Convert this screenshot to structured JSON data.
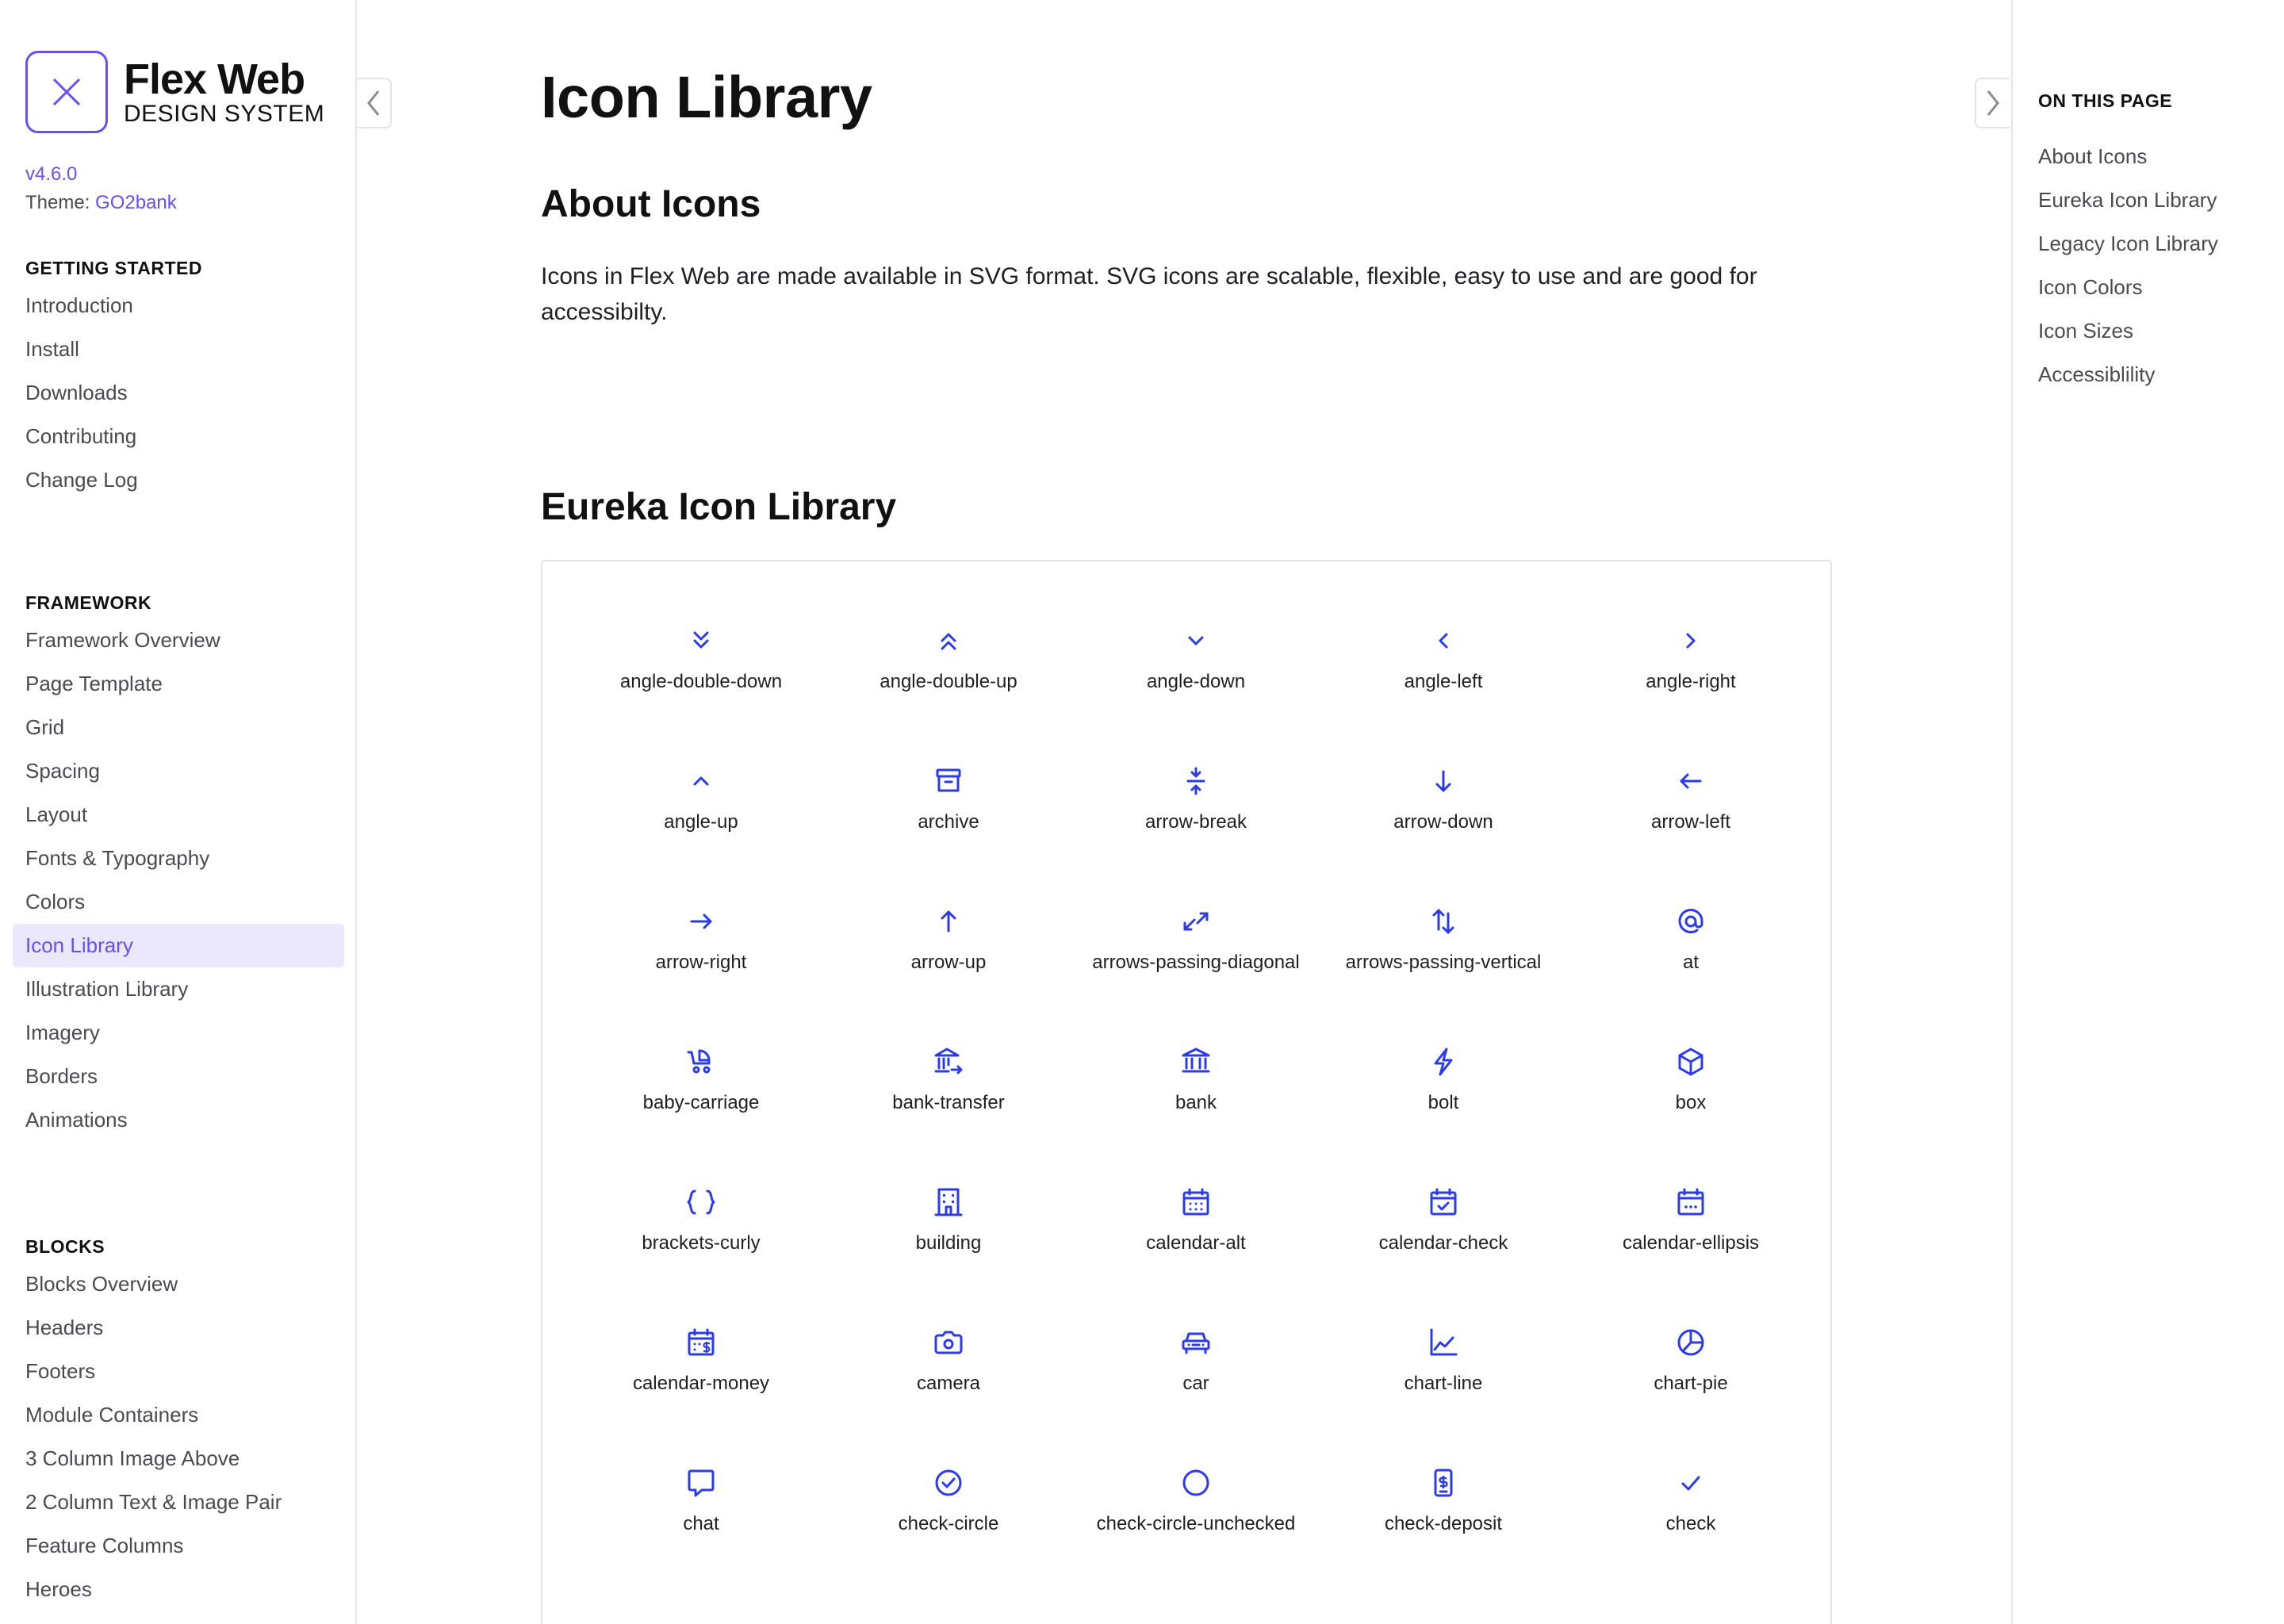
{
  "brand": {
    "title": "Flex Web",
    "subtitle": "DESIGN SYSTEM",
    "version": "v4.6.0",
    "theme_label": "Theme:",
    "theme_value": "GO2bank",
    "accent": "#6a4ff0"
  },
  "sidebar": {
    "sections": [
      {
        "heading": "GETTING STARTED",
        "items": [
          "Introduction",
          "Install",
          "Downloads",
          "Contributing",
          "Change Log"
        ]
      },
      {
        "heading": "FRAMEWORK",
        "items": [
          "Framework Overview",
          "Page Template",
          "Grid",
          "Spacing",
          "Layout",
          "Fonts & Typography",
          "Colors",
          "Icon Library",
          "Illustration Library",
          "Imagery",
          "Borders",
          "Animations"
        ],
        "active": "Icon Library"
      },
      {
        "heading": "BLOCKS",
        "items": [
          "Blocks Overview",
          "Headers",
          "Footers",
          "Module Containers",
          "3 Column Image Above",
          "2 Column Text & Image Pair",
          "Feature Columns",
          "Heroes"
        ]
      }
    ]
  },
  "main": {
    "title": "Icon Library",
    "about_heading": "About Icons",
    "about_text": "Icons in Flex Web are made available in SVG format. SVG icons are scalable, flexible, easy to use and are good for accessibilty.",
    "eureka_heading": "Eureka Icon Library",
    "icon_color": "#2b3bea",
    "icons": [
      {
        "label": "angle-double-down",
        "icon": "angle-double-down-icon"
      },
      {
        "label": "angle-double-up",
        "icon": "angle-double-up-icon"
      },
      {
        "label": "angle-down",
        "icon": "angle-down-icon"
      },
      {
        "label": "angle-left",
        "icon": "angle-left-icon"
      },
      {
        "label": "angle-right",
        "icon": "angle-right-icon"
      },
      {
        "label": "angle-up",
        "icon": "angle-up-icon"
      },
      {
        "label": "archive",
        "icon": "archive-icon"
      },
      {
        "label": "arrow-break",
        "icon": "arrow-break-icon"
      },
      {
        "label": "arrow-down",
        "icon": "arrow-down-icon"
      },
      {
        "label": "arrow-left",
        "icon": "arrow-left-icon"
      },
      {
        "label": "arrow-right",
        "icon": "arrow-right-icon"
      },
      {
        "label": "arrow-up",
        "icon": "arrow-up-icon"
      },
      {
        "label": "arrows-passing-diagonal",
        "icon": "arrows-passing-diagonal-icon"
      },
      {
        "label": "arrows-passing-vertical",
        "icon": "arrows-passing-vertical-icon"
      },
      {
        "label": "at",
        "icon": "at-icon"
      },
      {
        "label": "baby-carriage",
        "icon": "baby-carriage-icon"
      },
      {
        "label": "bank-transfer",
        "icon": "bank-transfer-icon"
      },
      {
        "label": "bank",
        "icon": "bank-icon"
      },
      {
        "label": "bolt",
        "icon": "bolt-icon"
      },
      {
        "label": "box",
        "icon": "box-icon"
      },
      {
        "label": "brackets-curly",
        "icon": "brackets-curly-icon"
      },
      {
        "label": "building",
        "icon": "building-icon"
      },
      {
        "label": "calendar-alt",
        "icon": "calendar-alt-icon"
      },
      {
        "label": "calendar-check",
        "icon": "calendar-check-icon"
      },
      {
        "label": "calendar-ellipsis",
        "icon": "calendar-ellipsis-icon"
      },
      {
        "label": "calendar-money",
        "icon": "calendar-money-icon"
      },
      {
        "label": "camera",
        "icon": "camera-icon"
      },
      {
        "label": "car",
        "icon": "car-icon"
      },
      {
        "label": "chart-line",
        "icon": "chart-line-icon"
      },
      {
        "label": "chart-pie",
        "icon": "chart-pie-icon"
      },
      {
        "label": "chat",
        "icon": "chat-icon"
      },
      {
        "label": "check-circle",
        "icon": "check-circle-icon"
      },
      {
        "label": "check-circle-unchecked",
        "icon": "check-circle-unchecked-icon"
      },
      {
        "label": "check-deposit",
        "icon": "check-deposit-icon"
      },
      {
        "label": "check",
        "icon": "check-icon"
      }
    ]
  },
  "toc": {
    "heading": "ON THIS PAGE",
    "items": [
      "About Icons",
      "Eureka Icon Library",
      "Legacy Icon Library",
      "Icon Colors",
      "Icon Sizes",
      "Accessiblility"
    ]
  }
}
